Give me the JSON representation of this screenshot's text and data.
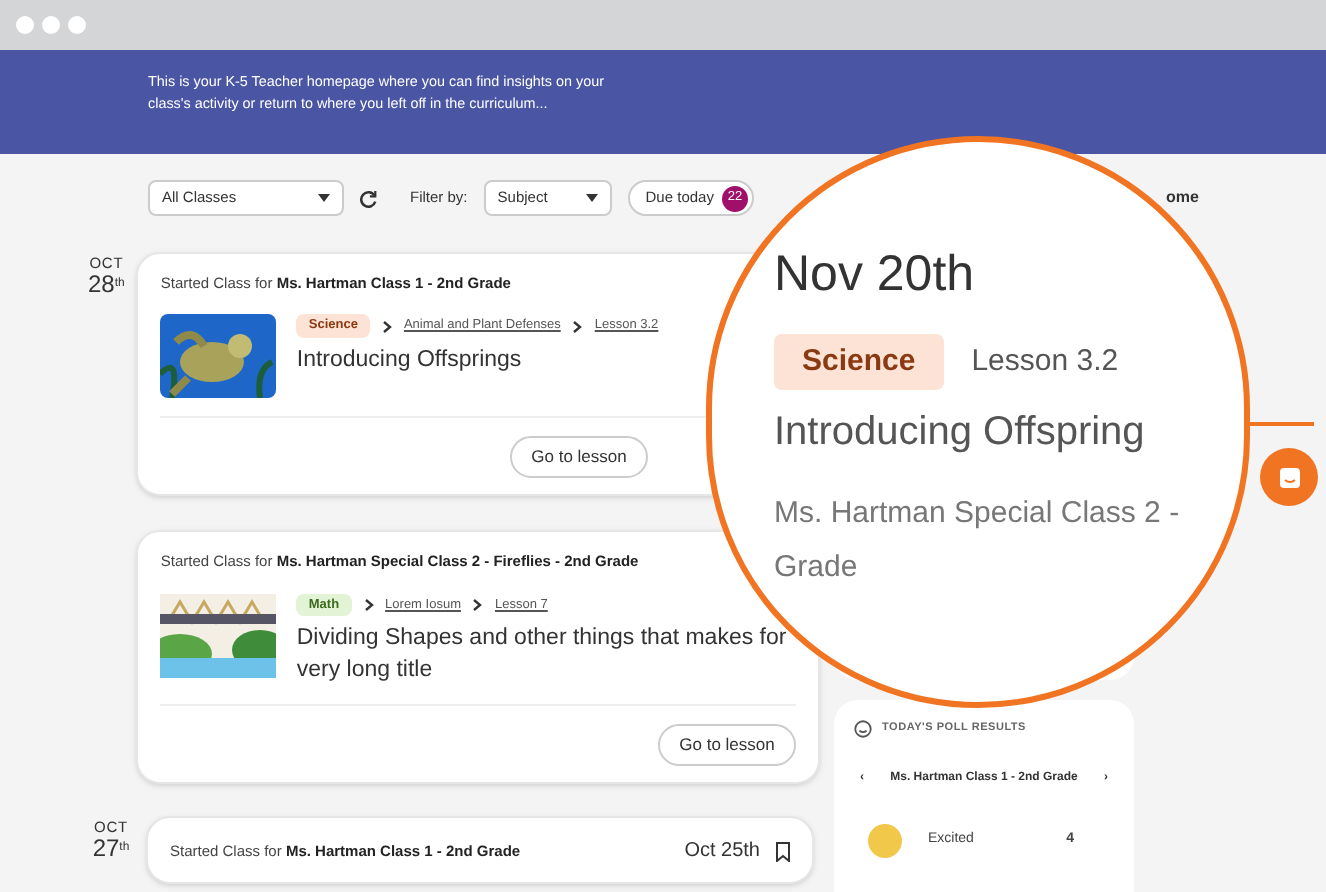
{
  "banner": {
    "text": "This is your K-5 Teacher homepage where you can find insights on your class's activity or return to where you left off in the curriculum..."
  },
  "filters": {
    "class_select": "All Classes",
    "filter_label": "Filter by:",
    "subject_select": "Subject",
    "due_today": {
      "label": "Due today",
      "count": "22"
    },
    "cut_text": "ome"
  },
  "days": [
    {
      "month": "OCT",
      "day": "28",
      "suffix": "th",
      "cards": [
        {
          "kind": "full",
          "prefix": "Started Class for",
          "class_name": "Ms. Hartman Class 1 - 2nd Grade",
          "subject": {
            "label": "Science",
            "kind": "science"
          },
          "crumbs": [
            "Animal and Plant Defenses",
            "Lesson 3.2"
          ],
          "title": "Introducing Offsprings",
          "button": "Go to lesson"
        },
        {
          "kind": "full",
          "prefix": "Started Class for",
          "class_name": "Ms. Hartman Special Class 2 - Fireflies - 2nd Grade",
          "subject": {
            "label": "Math",
            "kind": "math"
          },
          "crumbs": [
            "Lorem Iosum",
            "Lesson 7"
          ],
          "title": "Dividing Shapes and other things that makes for very long title",
          "button": "Go to lesson"
        }
      ]
    },
    {
      "month": "OCT",
      "day": "27",
      "suffix": "th",
      "cards": [
        {
          "kind": "header",
          "prefix": "Started Class for",
          "class_name": "Ms. Hartman Class 1 - 2nd Grade",
          "date": "Oct 25th"
        }
      ]
    }
  ],
  "poll": {
    "title": "TODAY'S POLL RESULTS",
    "prev": "‹",
    "next": "›",
    "class_name": "Ms. Hartman Class 1 - 2nd Grade",
    "results": [
      {
        "label": "Excited",
        "count": "4"
      }
    ]
  },
  "magnifier": {
    "date": "Nov 20th",
    "subject": {
      "label": "Science",
      "kind": "science"
    },
    "lesson": "Lesson 3.2",
    "title": "Introducing Offspring",
    "class_name": "Ms. Hartman Special Class 2 -",
    "class_name_2": "Grade"
  }
}
